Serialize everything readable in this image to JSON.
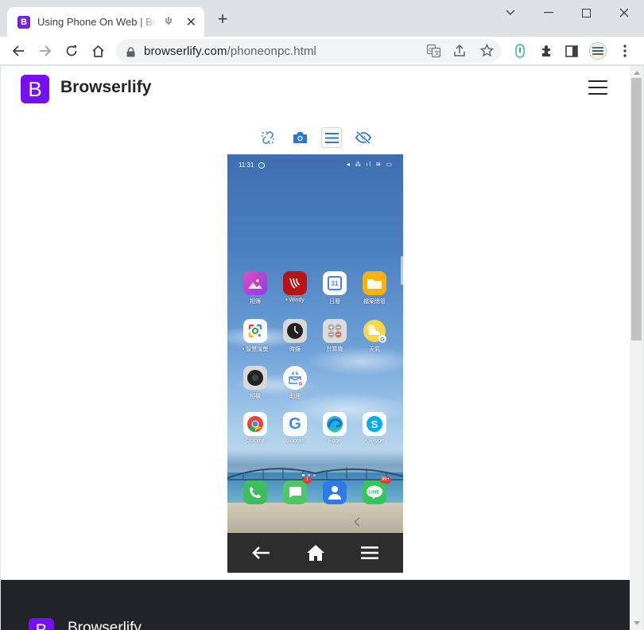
{
  "browser": {
    "tab": {
      "favicon_letter": "B",
      "title": "Using Phone On Web | Browserlify",
      "close": "✕"
    },
    "new_tab": "+",
    "window": {
      "minimize": "minimize-icon",
      "maximize": "maximize-icon",
      "close": "close-icon",
      "tab_search": "chevron-down-icon"
    },
    "address": {
      "host": "browserlify.com",
      "path": "/phoneonpc.html"
    }
  },
  "site": {
    "logo_letter": "B",
    "name": "Browserlify",
    "brand_color": "#7610f2"
  },
  "phone": {
    "status": {
      "time": "11:31",
      "icons": "◂ ⁂ ıl ≋ ▭"
    },
    "apps": [
      {
        "label": "相簿",
        "color": "#c23fd3"
      },
      {
        "label": "• Windy",
        "color": "#b81414"
      },
      {
        "label": "日曆",
        "color": "#ffffff"
      },
      {
        "label": "檔案總管",
        "color": "#f6b20e"
      },
      {
        "label": "• 智慧識螢",
        "color": "#ffffff"
      },
      {
        "label": "時鐘",
        "color": "#d8d8d8"
      },
      {
        "label": "計算機",
        "color": "#d8d8d8"
      },
      {
        "label": "天氣",
        "color": "#ffffff"
      },
      {
        "label": "相機",
        "color": "#d8d8d8"
      },
      {
        "label": "助理",
        "color": "#ffffff"
      },
      {
        "label": "Chrome",
        "color": "#ffffff"
      },
      {
        "label": "Google",
        "color": "#ffffff"
      },
      {
        "label": "Edge",
        "color": "#ffffff"
      },
      {
        "label": "• Skype",
        "color": "#ffffff"
      }
    ],
    "dock": [
      {
        "name": "phone",
        "color": "#3dbd5d",
        "badge": ""
      },
      {
        "name": "messages",
        "color": "#4cc764",
        "badge": "1"
      },
      {
        "name": "contacts",
        "color": "#2d7be5",
        "badge": ""
      },
      {
        "name": "line",
        "color": "#36c55a",
        "badge": "99+"
      }
    ],
    "app_glyphs": [
      "",
      "",
      "31",
      "",
      "",
      "",
      "",
      "",
      "",
      "",
      "",
      "G",
      "",
      "S"
    ]
  },
  "footer": {
    "logo_letter": "B",
    "name": "Browserlify"
  }
}
